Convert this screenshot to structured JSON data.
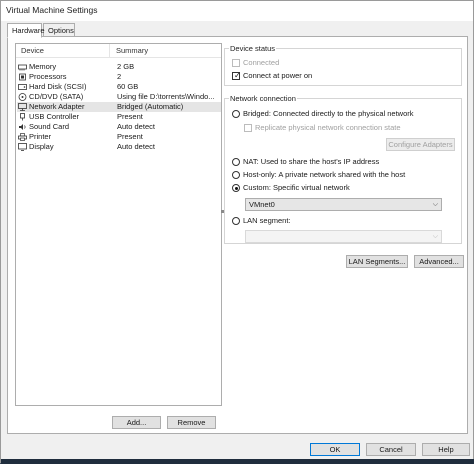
{
  "window": {
    "title": "Virtual Machine Settings"
  },
  "tabs": [
    {
      "label": "Hardware",
      "active": true
    },
    {
      "label": "Options",
      "active": false
    }
  ],
  "device_list": {
    "columns": {
      "device": "Device",
      "summary": "Summary"
    },
    "rows": [
      {
        "icon": "memory-icon",
        "device": "Memory",
        "summary": "2 GB",
        "selected": false
      },
      {
        "icon": "processor-icon",
        "device": "Processors",
        "summary": "2",
        "selected": false
      },
      {
        "icon": "hard-disk-icon",
        "device": "Hard Disk (SCSI)",
        "summary": "60 GB",
        "selected": false
      },
      {
        "icon": "cd-dvd-icon",
        "device": "CD/DVD (SATA)",
        "summary": "Using file D:\\torrents\\Windo...",
        "selected": false
      },
      {
        "icon": "network-adapter-icon",
        "device": "Network Adapter",
        "summary": "Bridged (Automatic)",
        "selected": true
      },
      {
        "icon": "usb-icon",
        "device": "USB Controller",
        "summary": "Present",
        "selected": false
      },
      {
        "icon": "sound-card-icon",
        "device": "Sound Card",
        "summary": "Auto detect",
        "selected": false
      },
      {
        "icon": "printer-icon",
        "device": "Printer",
        "summary": "Present",
        "selected": false
      },
      {
        "icon": "display-icon",
        "device": "Display",
        "summary": "Auto detect",
        "selected": false
      }
    ],
    "add_label": "Add...",
    "remove_label": "Remove"
  },
  "device_status": {
    "title": "Device status",
    "connected_label": "Connected",
    "connected_checked": false,
    "connect_power_label": "Connect at power on",
    "connect_power_checked": true
  },
  "network_connection": {
    "title": "Network connection",
    "bridged_label": "Bridged: Connected directly to the physical network",
    "replicate_label": "Replicate physical network connection state",
    "configure_adapters_label": "Configure Adapters",
    "nat_label": "NAT: Used to share the host's IP address",
    "hostonly_label": "Host-only: A private network shared with the host",
    "custom_label": "Custom: Specific virtual network",
    "custom_value": "VMnet0",
    "lan_label": "LAN segment:",
    "lan_value": "",
    "selected": "custom",
    "lan_segments_label": "LAN Segments...",
    "advanced_label": "Advanced..."
  },
  "footer": {
    "ok_label": "OK",
    "cancel_label": "Cancel",
    "help_label": "Help"
  },
  "colors": {
    "accent": "#0078d7",
    "selected_row": "#e5e5e5",
    "window_bg": "#f0f0f0"
  }
}
